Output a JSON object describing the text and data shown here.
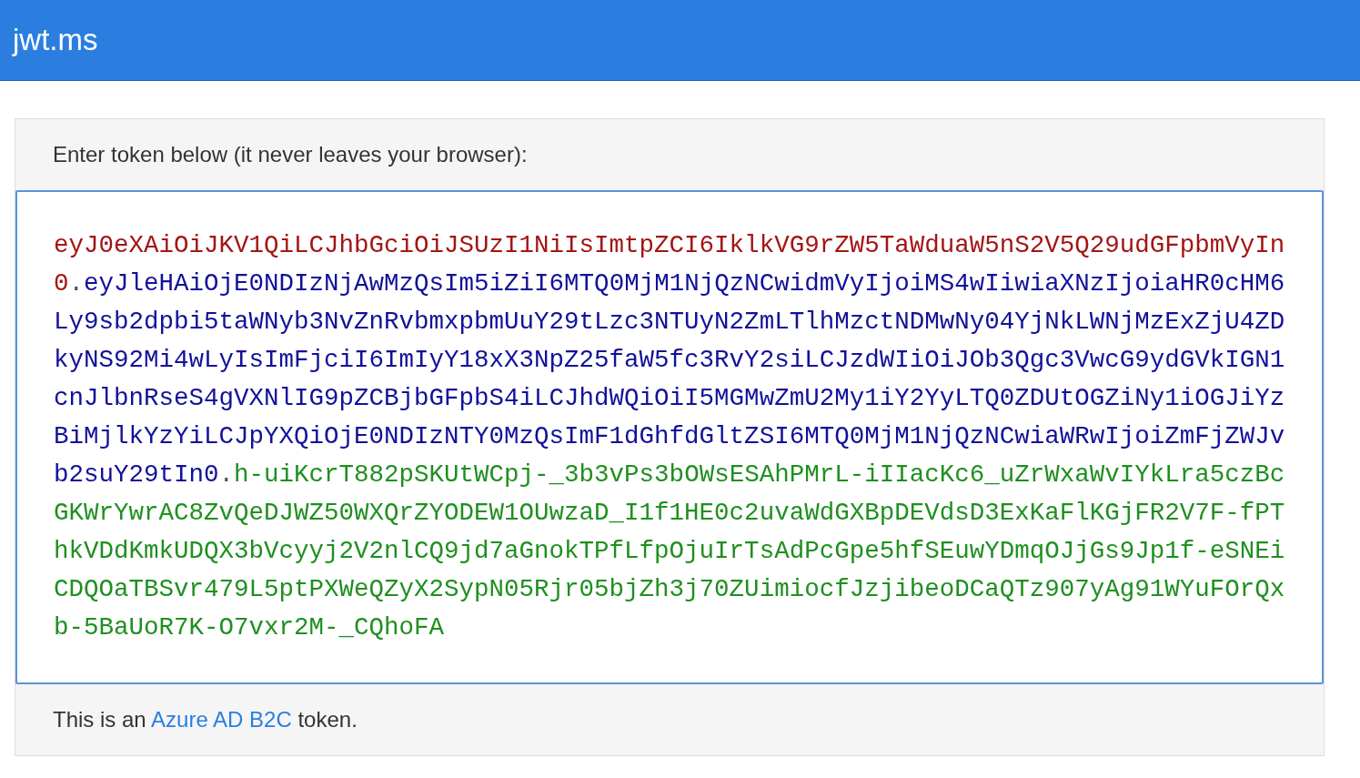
{
  "header": {
    "title": "jwt.ms"
  },
  "card": {
    "prompt": "Enter token below (it never leaves your browser):",
    "token_lines": [
      [
        {
          "color": "#a31515",
          "text": "eyJ0eXAiOiJKV1QiLCJhbGciOiJSUzI1NiIsImtpZCI6IklkVG9rZW5TaWduaW5nS2V5Q29udGFpbmVyIn"
        }
      ],
      [
        {
          "color": "#a31515",
          "text": "0"
        },
        {
          "color": "#555555",
          "text": "."
        },
        {
          "color": "#11119a",
          "text": "eyJleHAiOjE0NDIzNjAwMzQsIm5iZiI6MTQ0MjM1NjQzNCwidmVyIjoiMS4wIiwiaXNzIjoiaHR0cHM6"
        }
      ],
      [
        {
          "color": "#11119a",
          "text": "Ly9sb2dpbi5taWNyb3NvZnRvbmxpbmUuY29tLzc3NTUyN2ZmLTlhMzctNDMwNy04YjNkLWNjMzExZjU4ZD"
        }
      ],
      [
        {
          "color": "#11119a",
          "text": "kyNS92Mi4wLyIsImFjciI6ImIyY18xX3NpZ25faW5fc3RvY2siLCJzdWIiOiJOb3Qgc3VwcG9ydGVkIGN1"
        }
      ],
      [
        {
          "color": "#11119a",
          "text": "cnJlbnRseS4gVXNlIG9pZCBjbGFpbS4iLCJhdWQiOiI5MGMwZmU2My1iY2YyLTQ0ZDUtOGZiNy1iOGJiYz"
        }
      ],
      [
        {
          "color": "#11119a",
          "text": "BiMjlkYzYiLCJpYXQiOjE0NDIzNTY0MzQsImF1dGhfdGltZSI6MTQ0MjM1NjQzNCwiaWRwIjoiZmFjZWJv"
        }
      ],
      [
        {
          "color": "#11119a",
          "text": "b2suY29tIn0"
        },
        {
          "color": "#555555",
          "text": "."
        },
        {
          "color": "#1f8f1f",
          "text": "h-uiKcrT882pSKUtWCpj-_3b3vPs3bOWsESAhPMrL-iIIacKc6_uZrWxaWvIYkLra5czBc"
        }
      ],
      [
        {
          "color": "#1f8f1f",
          "text": "GKWrYwrAC8ZvQeDJWZ50WXQrZYODEW1OUwzaD_I1f1HE0c2uvaWdGXBpDEVdsD3ExKaFlKGjFR2V7F-fPT"
        }
      ],
      [
        {
          "color": "#1f8f1f",
          "text": "hkVDdKmkUDQX3bVcyyj2V2nlCQ9jd7aGnokTPfLfpOjuIrTsAdPcGpe5hfSEuwYDmqOJjGs9Jp1f-eSNEi"
        }
      ],
      [
        {
          "color": "#1f8f1f",
          "text": "CDQOaTBSvr479L5ptPXWeQZyX2SypN05Rjr05bjZh3j70ZUimiocfJzjibeoDCaQTz907yAg91WYuFOrQx"
        }
      ],
      [
        {
          "color": "#1f8f1f",
          "text": "b-5BaUoR7K-O7vxr2M-_CQhoFA"
        }
      ]
    ],
    "result": {
      "before": "This is an ",
      "link": "Azure AD B2C",
      "after": " token."
    }
  }
}
